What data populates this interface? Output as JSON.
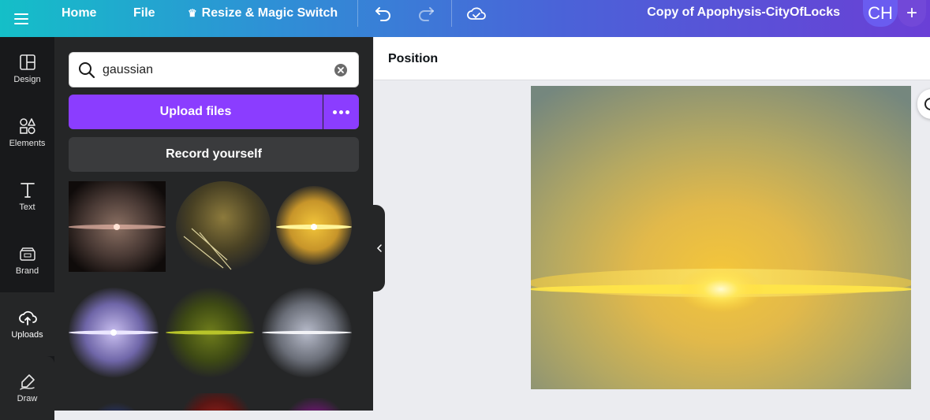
{
  "topbar": {
    "home": "Home",
    "file": "File",
    "resize": "Resize & Magic Switch",
    "doc_title": "Copy of Apophysis-CityOfLocks",
    "avatar": "CH",
    "plus": "+"
  },
  "rail": {
    "design": "Design",
    "elements": "Elements",
    "text": "Text",
    "brand": "Brand",
    "uploads": "Uploads",
    "draw": "Draw"
  },
  "panel": {
    "search_value": "gaussian",
    "upload_files": "Upload files",
    "record_yourself": "Record yourself"
  },
  "canvas": {
    "position_label": "Position"
  },
  "colors": {
    "accent": "#8b3dff",
    "panel_bg": "#252627",
    "rail_bg": "#18191b"
  }
}
